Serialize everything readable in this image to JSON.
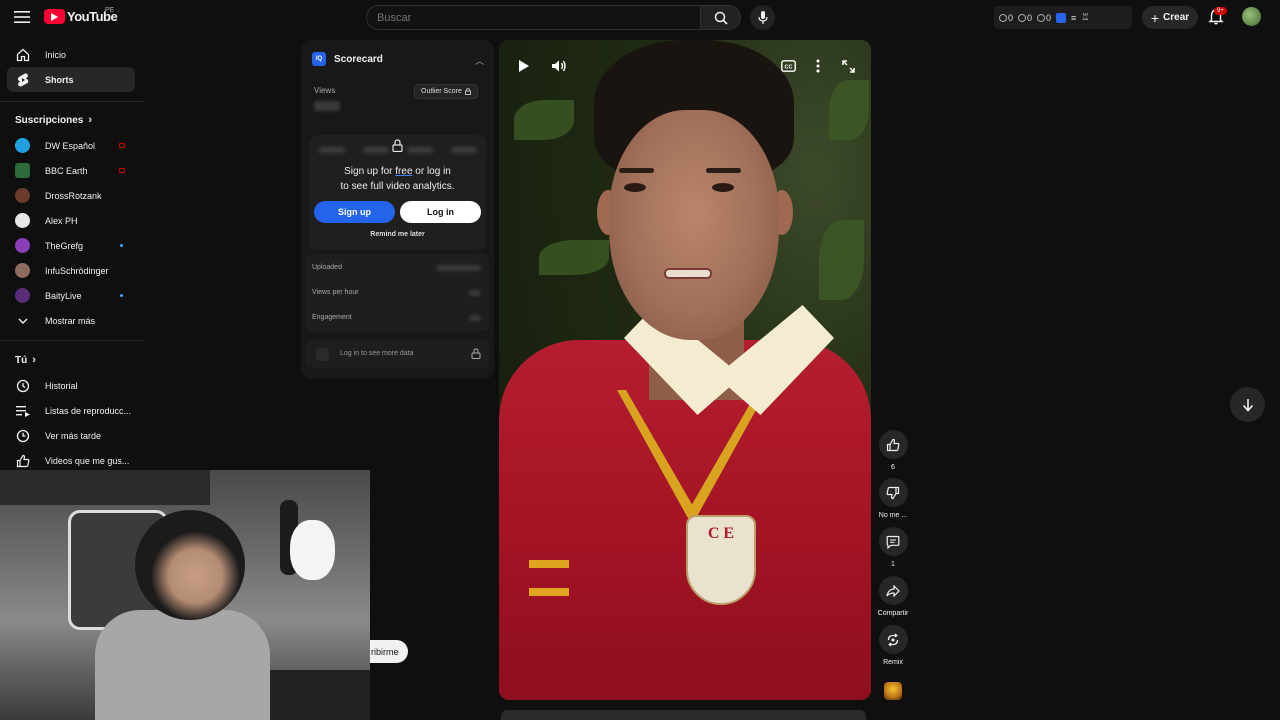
{
  "header": {
    "logo_text": "YouTube",
    "region": "PE",
    "search_placeholder": "Buscar",
    "ext_stats": [
      "0",
      "0",
      "0"
    ],
    "create_label": "Crear",
    "notifications_badge": "9+"
  },
  "sidebar": {
    "main": [
      {
        "label": "Inicio",
        "icon": "home-icon"
      },
      {
        "label": "Shorts",
        "icon": "shorts-icon",
        "active": true
      }
    ],
    "subscriptions_title": "Suscripciones",
    "subscriptions": [
      {
        "label": "DW Español",
        "status": "live"
      },
      {
        "label": "BBC Earth",
        "status": "live"
      },
      {
        "label": "DrossRotzank",
        "status": ""
      },
      {
        "label": "Alex PH",
        "status": ""
      },
      {
        "label": "TheGrefg",
        "status": "new"
      },
      {
        "label": "InfuSchrödinger",
        "status": ""
      },
      {
        "label": "BaityLive",
        "status": "new"
      }
    ],
    "show_more": "Mostrar más",
    "you_title": "Tú",
    "you_items": [
      {
        "label": "Historial",
        "icon": "history-icon"
      },
      {
        "label": "Listas de reproducc...",
        "icon": "playlists-icon"
      },
      {
        "label": "Ver más tarde",
        "icon": "watch-later-icon"
      },
      {
        "label": "Videos que me gus...",
        "icon": "liked-videos-icon"
      }
    ]
  },
  "subscribe_partial": "ribirme",
  "scorecard": {
    "title": "Scorecard",
    "logo": "IQ",
    "views_label": "Views",
    "outlier_label": "Outlier Score",
    "message_pre": "Sign up for ",
    "message_free": "free",
    "message_post": " or log in",
    "message_line2": "to see full video analytics.",
    "signup": "Sign up",
    "login": "Log in",
    "remind": "Remind me later",
    "stats": [
      "Uploaded",
      "Views per hour",
      "Engagement"
    ],
    "more_text": "Log in to see more data"
  },
  "video": {
    "crest_text": "C E"
  },
  "actions": {
    "like_count": "6",
    "dislike_label": "No me ...",
    "comments_count": "1",
    "share_label": "Compartir",
    "remix_label": "Remix"
  },
  "colors": {
    "background": "#0f0f0f",
    "brand_red": "#ff0033",
    "accent_blue": "#2563eb"
  }
}
